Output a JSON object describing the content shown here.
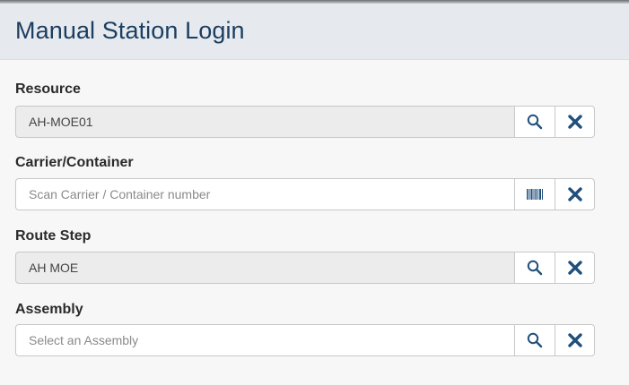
{
  "header": {
    "title": "Manual Station Login"
  },
  "fields": [
    {
      "label": "Resource",
      "value": "AH-MOE01",
      "placeholder": "",
      "action_icon": "search-icon",
      "clear_icon": "close-icon"
    },
    {
      "label": "Carrier/Container",
      "value": "",
      "placeholder": "Scan Carrier / Container number",
      "action_icon": "barcode-icon",
      "clear_icon": "close-icon"
    },
    {
      "label": "Route Step",
      "value": "AH MOE",
      "placeholder": "",
      "action_icon": "search-icon",
      "clear_icon": "close-icon"
    },
    {
      "label": "Assembly",
      "value": "",
      "placeholder": "Select an Assembly",
      "action_icon": "search-icon",
      "clear_icon": "close-icon"
    }
  ],
  "colors": {
    "title": "#1c3e60",
    "icon_blue": "#1f4f7a",
    "header_bg": "#e6eaef",
    "readonly_bg": "#ececec"
  }
}
